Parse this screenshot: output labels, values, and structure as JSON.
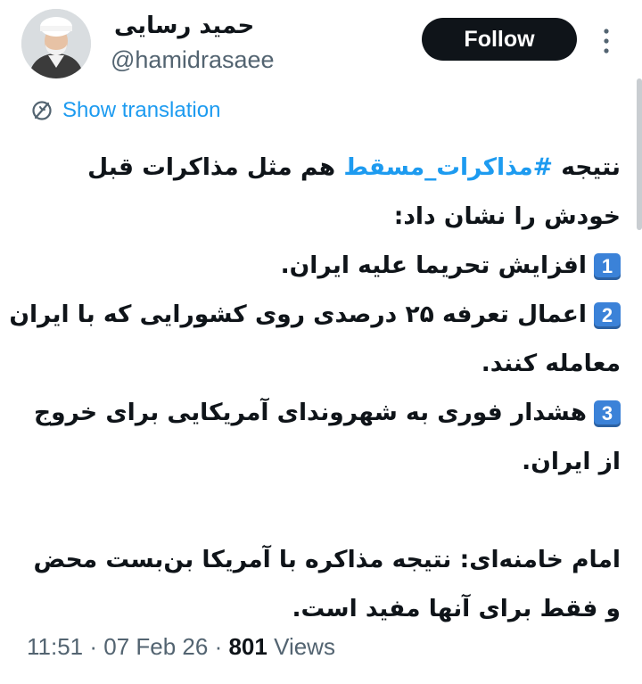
{
  "author": {
    "display_name": "حمید رسایی",
    "handle": "@hamidrasaee"
  },
  "actions": {
    "follow_label": "Follow",
    "more_icon": "more-vertical-icon"
  },
  "translation": {
    "label": "Show translation",
    "icon": "globe-translate-icon"
  },
  "tweet": {
    "line1_pre": "نتیجه ",
    "hashtag": "#مذاکرات_مسقط",
    "line1_post": " هم مثل مذاکرات قبل",
    "line2": "خودش را نشان داد:",
    "item1_num": "1",
    "item1_text": "افزایش تحریما علیه ایران.",
    "item2_num": "2",
    "item2_text": "اعمال تعرفه ۲۵ درصدی روی کشورایی که با ایران",
    "item2_cont": "معامله کنند.",
    "item3_num": "3",
    "item3_text": "هشدار فوری به شهروندای آمریکایی برای خروج",
    "item3_cont": "از ایران.",
    "quote_line1": "امام خامنه‌ای: نتیجه مذاکره با آمریکا بن‌بست محض",
    "quote_line2": "و فقط برای آنها مفید است."
  },
  "meta": {
    "time": "11:51",
    "sep1": " · ",
    "date": "07 Feb 26",
    "sep2": " · ",
    "views_count": "801",
    "views_label": " Views"
  },
  "colors": {
    "accent": "#1d9bf0",
    "button_bg": "#0f1419",
    "muted": "#536471",
    "keycap": "#3b82d8"
  }
}
